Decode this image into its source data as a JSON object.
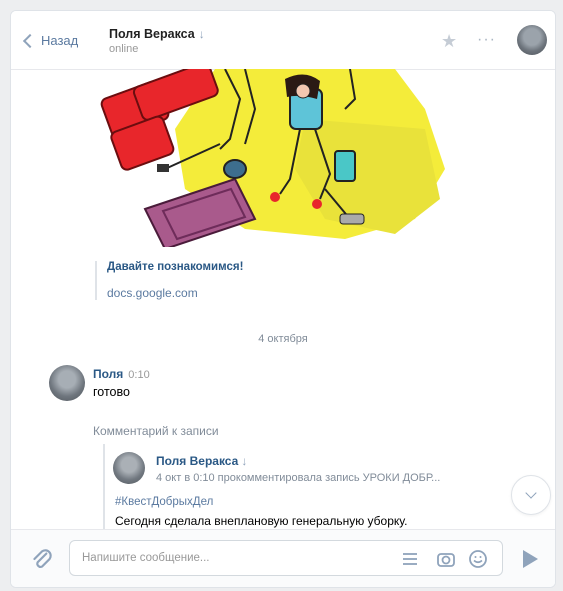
{
  "header": {
    "back_label": "Назад",
    "peer_name": "Поля Веракса",
    "peer_status": "online"
  },
  "attachment": {
    "title": "Давайте познакомимся!",
    "url": "docs.google.com"
  },
  "date_separator": "4 октября",
  "message": {
    "author": "Поля",
    "time": "0:10",
    "text": "готово"
  },
  "forward": {
    "label": "Комментарий к записи",
    "name": "Поля Веракса",
    "subline": "4 окт в 0:10 прокомментировала запись УРОКИ ДОБР...",
    "hashtag": "#КвестДобрыхДел",
    "body": "Сегодня сделала внеплановую генеральную уборку."
  },
  "composer": {
    "placeholder": "Напишите сообщение..."
  },
  "icons": [
    "back-chevron-icon",
    "star-icon",
    "more-icon",
    "scroll-down-icon",
    "attach-icon",
    "template-icon",
    "camera-icon",
    "emoji-icon",
    "send-icon"
  ],
  "colors": {
    "link": "#2a5885",
    "muted": "#818c99",
    "accent_icon": "#8fa3bb"
  }
}
